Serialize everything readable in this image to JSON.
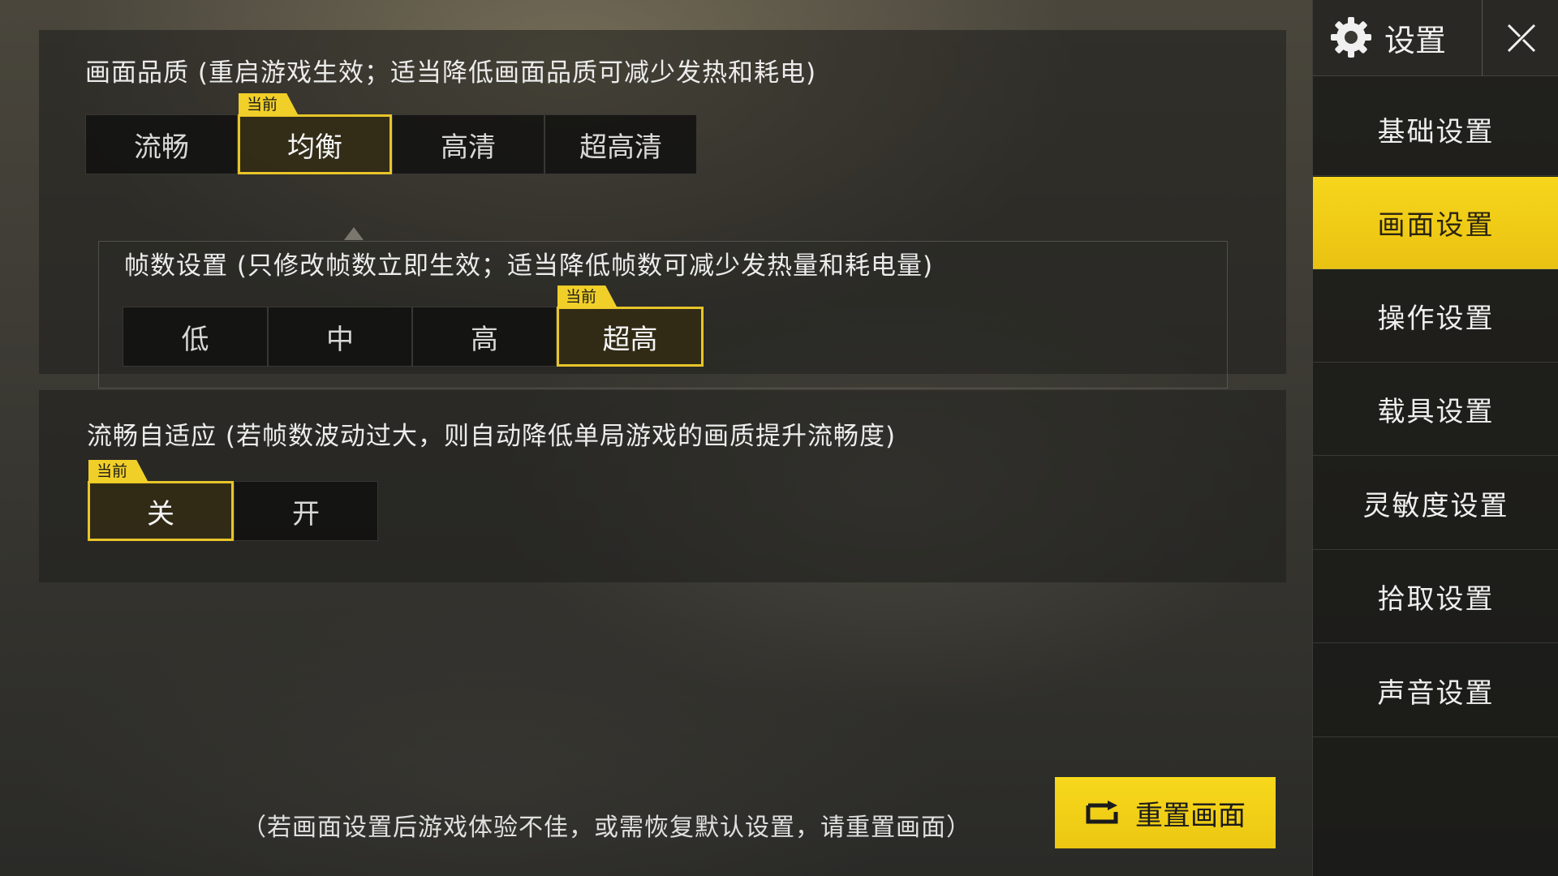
{
  "graphics_quality": {
    "title": "画面品质 (重启游戏生效；适当降低画面品质可减少发热和耗电)",
    "options": [
      "流畅",
      "均衡",
      "高清",
      "超高清"
    ],
    "selected": "均衡"
  },
  "frame_rate": {
    "title": "帧数设置 (只修改帧数立即生效；适当降低帧数可减少发热量和耗电量)",
    "options": [
      "低",
      "中",
      "高",
      "超高"
    ],
    "selected": "超高"
  },
  "adaptive": {
    "title": "流畅自适应 (若帧数波动过大，则自动降低单局游戏的画质提升流畅度)",
    "options": [
      "关",
      "开"
    ],
    "selected": "关"
  },
  "current_badge": "当前",
  "footer": {
    "note": "（若画面设置后游戏体验不佳，或需恢复默认设置，请重置画面）",
    "reset_label": "重置画面"
  },
  "sidebar": {
    "title": "设置",
    "items": [
      {
        "label": "基础设置",
        "active": false
      },
      {
        "label": "画面设置",
        "active": true
      },
      {
        "label": "操作设置",
        "active": false
      },
      {
        "label": "载具设置",
        "active": false
      },
      {
        "label": "灵敏度设置",
        "active": false
      },
      {
        "label": "拾取设置",
        "active": false
      },
      {
        "label": "声音设置",
        "active": false
      }
    ]
  },
  "icons": {
    "settings": "gear-icon",
    "close": "close-icon",
    "reset": "reset-icon"
  },
  "colors": {
    "accent": "#F1CF29",
    "panel": "#1E1E1C"
  }
}
